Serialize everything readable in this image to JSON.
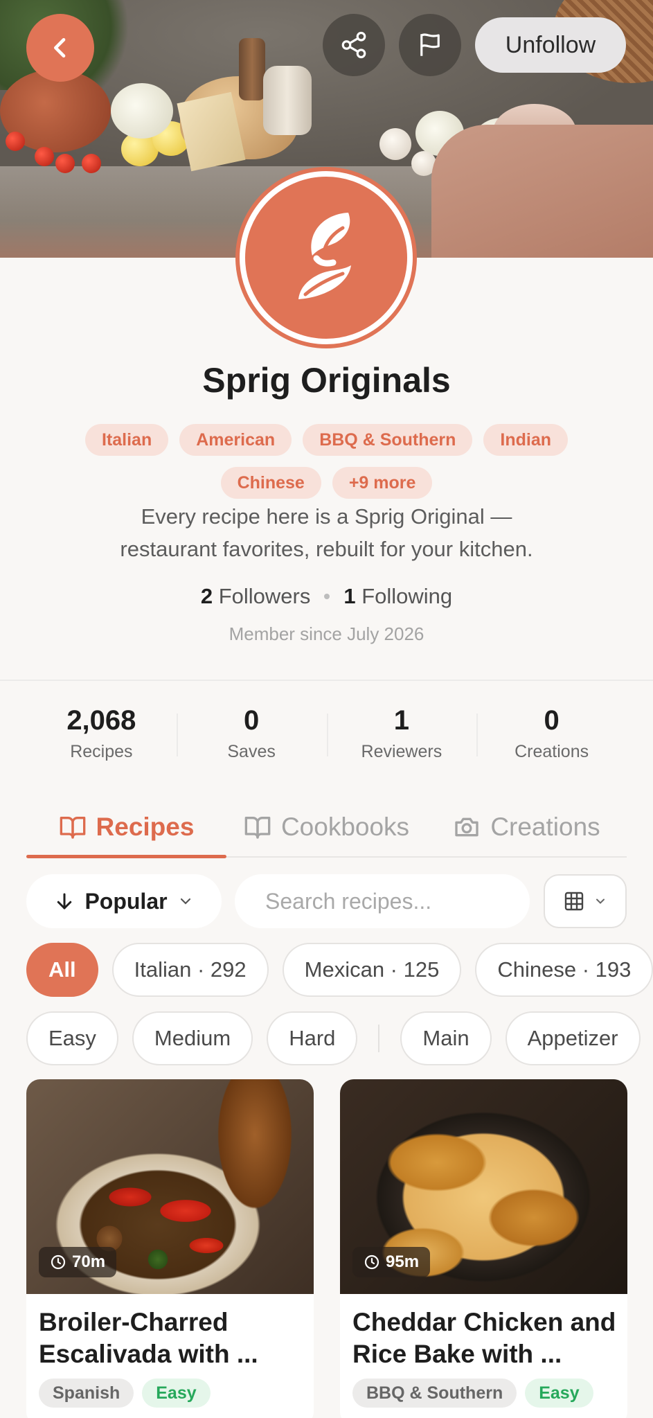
{
  "header": {
    "unfollow_label": "Unfollow"
  },
  "profile": {
    "name": "Sprig Originals",
    "cuisine_tags": [
      "Italian",
      "American",
      "BBQ & Southern",
      "Indian",
      "Chinese",
      "+9 more"
    ],
    "bio_line1": "Every recipe here is a Sprig Original —",
    "bio_line2": "restaurant favorites, rebuilt for your kitchen.",
    "followers_count": "2",
    "followers_label": "Followers",
    "following_count": "1",
    "following_label": "Following",
    "member_since": "Member since July 2026"
  },
  "stats": [
    {
      "value": "2,068",
      "label": "Recipes"
    },
    {
      "value": "0",
      "label": "Saves"
    },
    {
      "value": "1",
      "label": "Reviewers"
    },
    {
      "value": "0",
      "label": "Creations"
    }
  ],
  "tabs": [
    {
      "label": "Recipes",
      "icon": "book-icon",
      "active": true
    },
    {
      "label": "Cookbooks",
      "icon": "book-icon",
      "active": false
    },
    {
      "label": "Creations",
      "icon": "camera-icon",
      "active": false
    }
  ],
  "controls": {
    "sort_label": "Popular",
    "search_placeholder": "Search recipes..."
  },
  "cuisine_filters": [
    "All",
    "Italian · 292",
    "Mexican · 125",
    "Chinese · 193"
  ],
  "other_filters": [
    "Easy",
    "Medium",
    "Hard",
    "Main",
    "Appetizer"
  ],
  "recipes": [
    {
      "time": "70m",
      "title_line1": "Broiler-Charred",
      "title_line2": "Escalivada with ...",
      "cuisine": "Spanish",
      "difficulty": "Easy"
    },
    {
      "time": "95m",
      "title_line1": "Cheddar Chicken and",
      "title_line2": "Rice Bake with ...",
      "cuisine": "BBQ & Southern",
      "difficulty": "Easy"
    }
  ],
  "colors": {
    "accent": "#e07456",
    "easy_green": "#26a85b"
  }
}
